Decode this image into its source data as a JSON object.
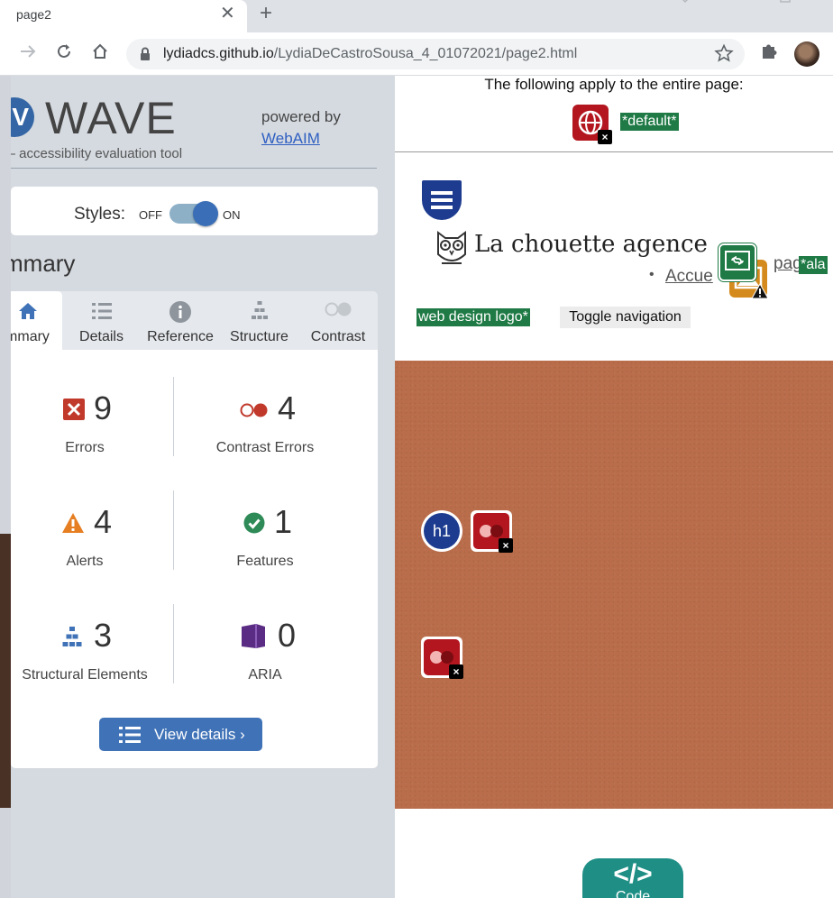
{
  "browser": {
    "tab_title": "page2",
    "tab_close": "✕",
    "new_tab": "+",
    "url_host": "lydiadcs.github.io",
    "url_path": "/LydiaDeCastroSousa_4_01072021/page2.html"
  },
  "wave": {
    "logo_letter": "V",
    "logo_text": "WAVE",
    "tagline": "— accessibility evaluation tool",
    "powered_by": "powered by",
    "webaim_link": "WebAIM",
    "styles_label": "Styles:",
    "styles_off": "OFF",
    "styles_on": "ON",
    "styles_state": "on",
    "summary_heading": "mmary",
    "tabs": [
      {
        "label": "mmary",
        "icon": "home-icon"
      },
      {
        "label": "Details",
        "icon": "list-icon"
      },
      {
        "label": "Reference",
        "icon": "info-icon"
      },
      {
        "label": "Structure",
        "icon": "structure-icon"
      },
      {
        "label": "Contrast",
        "icon": "contrast-icon"
      }
    ],
    "stats": {
      "errors": {
        "count": "9",
        "label": "Errors"
      },
      "contrast_errors": {
        "count": "4",
        "label": "Contrast Errors"
      },
      "alerts": {
        "count": "4",
        "label": "Alerts"
      },
      "features": {
        "count": "1",
        "label": "Features"
      },
      "structural": {
        "count": "3",
        "label": "Structural Elements"
      },
      "aria": {
        "count": "0",
        "label": "ARIA"
      }
    },
    "view_details": "View details ›",
    "colors": {
      "accent": "#3f72b7",
      "error": "#c0392b",
      "alert": "#e67e22",
      "feature": "#2e8b57",
      "aria": "#5b2c83"
    }
  },
  "page": {
    "note": "The following apply to the entire page:",
    "default_badge": "*default*",
    "title": "La chouette agence",
    "nav_accueil": "Accue",
    "nav_page": "pag",
    "nav_page_badge": "*ala",
    "logo_badge": "web design logo*",
    "toggle_nav": "Toggle navigation",
    "h1_badge": "h1",
    "code_symbol": "</>",
    "code_label": "Code"
  }
}
